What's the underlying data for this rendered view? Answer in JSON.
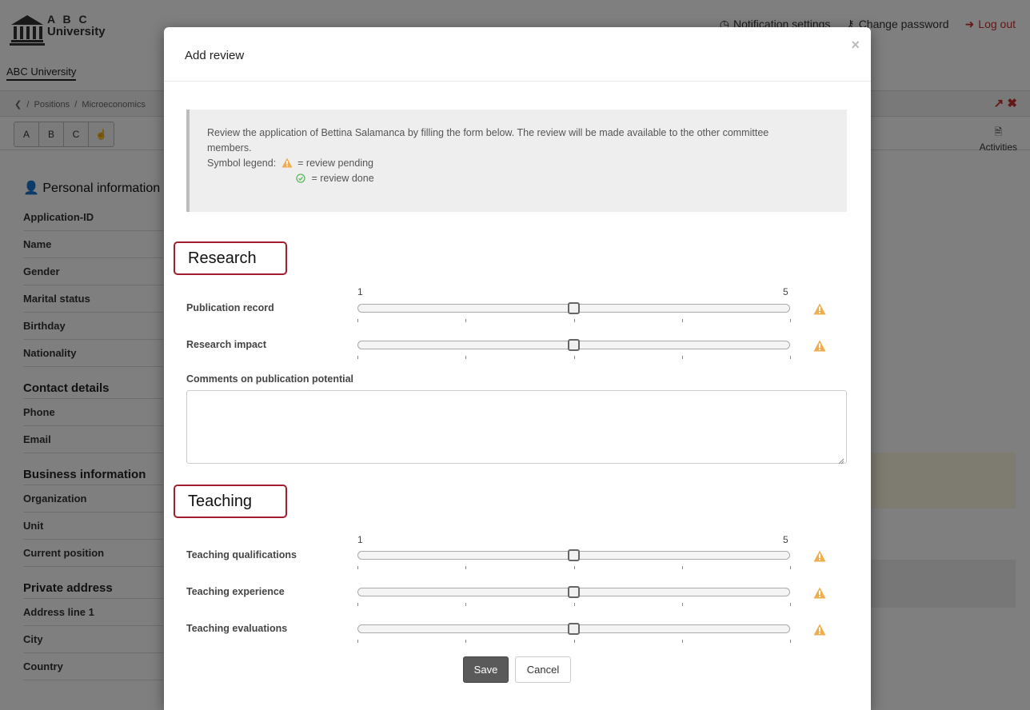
{
  "app": {
    "logo_line1": "A B C",
    "logo_line2": "University",
    "org_tab": "ABC University"
  },
  "top_links": {
    "notification": "Notification settings",
    "password": "Change password",
    "logout": "Log out"
  },
  "breadcrumb": {
    "positions": "Positions",
    "position": "Microeconomics"
  },
  "toolbar": {
    "filter_a": "A",
    "filter_b": "B",
    "filter_c": "C",
    "activities": "Activities"
  },
  "sidebar": {
    "personal_title": "Personal information",
    "personal_fields": [
      "Application-ID",
      "Name",
      "Gender",
      "Marital status",
      "Birthday",
      "Nationality"
    ],
    "contact_title": "Contact details",
    "contact_fields": [
      "Phone",
      "Email"
    ],
    "business_title": "Business information",
    "business_fields": [
      "Organization",
      "Unit",
      "Current position"
    ],
    "private_title": "Private address",
    "private_fields": [
      "Address line 1",
      "City",
      "Country"
    ]
  },
  "modal": {
    "title": "Add review",
    "close": "×",
    "intro_line1": "Review the application of Bettina Salamanca by filling the form below. The review will be made available to the other committee",
    "intro_line2": "members.",
    "legend_prefix": "Symbol legend:",
    "legend_pending": "= review pending",
    "legend_done": "= review done",
    "research": {
      "title": "Research",
      "scale_min": "1",
      "scale_max": "5",
      "criteria": [
        {
          "label": "Publication record",
          "value": 3
        },
        {
          "label": "Research impact",
          "value": 3
        }
      ],
      "comments_label": "Comments on publication potential",
      "comments_value": ""
    },
    "teaching": {
      "title": "Teaching",
      "scale_min": "1",
      "scale_max": "5",
      "criteria": [
        {
          "label": "Teaching qualifications",
          "value": 3
        },
        {
          "label": "Teaching experience",
          "value": 3
        },
        {
          "label": "Teaching evaluations",
          "value": 3
        }
      ]
    },
    "save": "Save",
    "cancel": "Cancel"
  },
  "colors": {
    "warning": "#f0ad4e",
    "done": "#5cb85c",
    "section_border": "#a01e2e"
  }
}
